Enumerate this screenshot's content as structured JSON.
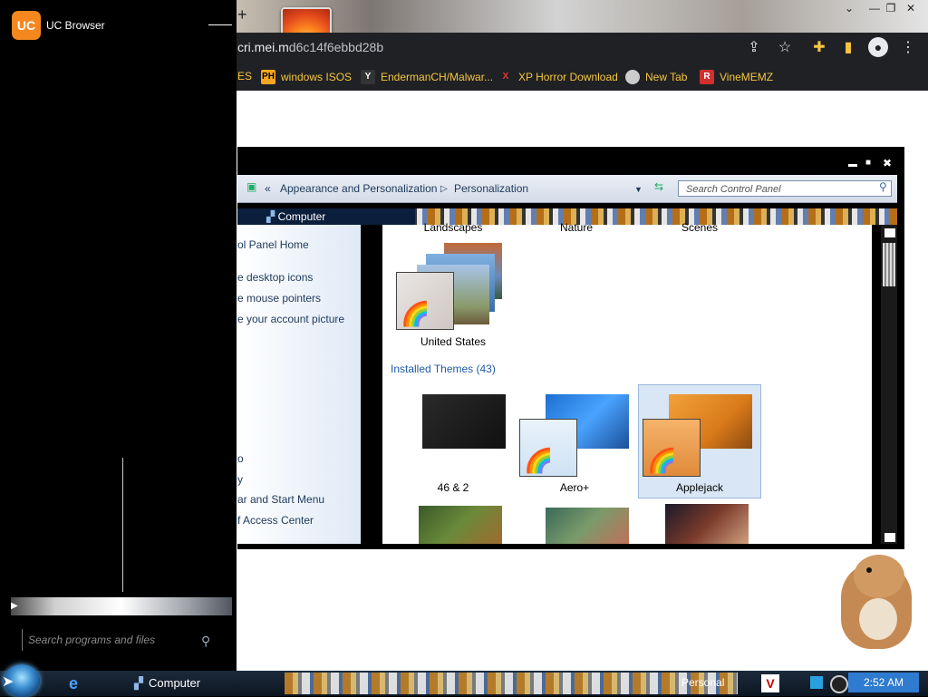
{
  "browser": {
    "url_host": "cri.mei.m",
    "url_rest": "d6c14f6ebbd28b",
    "bookmarks": [
      {
        "icon": "",
        "label": "ES"
      },
      {
        "icon": "PH",
        "label": "windows ISOS"
      },
      {
        "icon": "Y",
        "label": "EndermanCH/Malwar..."
      },
      {
        "icon": "X",
        "label": "XP Horror Download"
      },
      {
        "icon": "",
        "label": "New Tab"
      },
      {
        "icon": "R",
        "label": "VineMEMZ"
      }
    ]
  },
  "control_panel": {
    "breadcrumb_prefix": "«",
    "breadcrumb": [
      "Appearance and Personalization",
      "Personalization"
    ],
    "search_placeholder": "Search Control Panel",
    "computer_tab": "Computer",
    "tasks": [
      "ol Panel Home",
      "e desktop icons",
      "e mouse pointers",
      "e your account picture",
      "o",
      "y",
      "ar and Start Menu",
      "f Access Center"
    ],
    "top_theme_labels": [
      "Landscapes",
      "Nature",
      "Scenes"
    ],
    "single_theme_label": "United States",
    "installed_header": "Installed Themes (43)",
    "installed_themes": [
      "46 & 2",
      "Aero+",
      "Applejack"
    ]
  },
  "start_menu": {
    "pinned_app": "UC Browser",
    "uc_icon_text": "UC",
    "search_placeholder": "Search programs and files"
  },
  "taskbar": {
    "computer_label": "Computer",
    "personal_label": "Personal",
    "clock": "2:52 AM"
  }
}
